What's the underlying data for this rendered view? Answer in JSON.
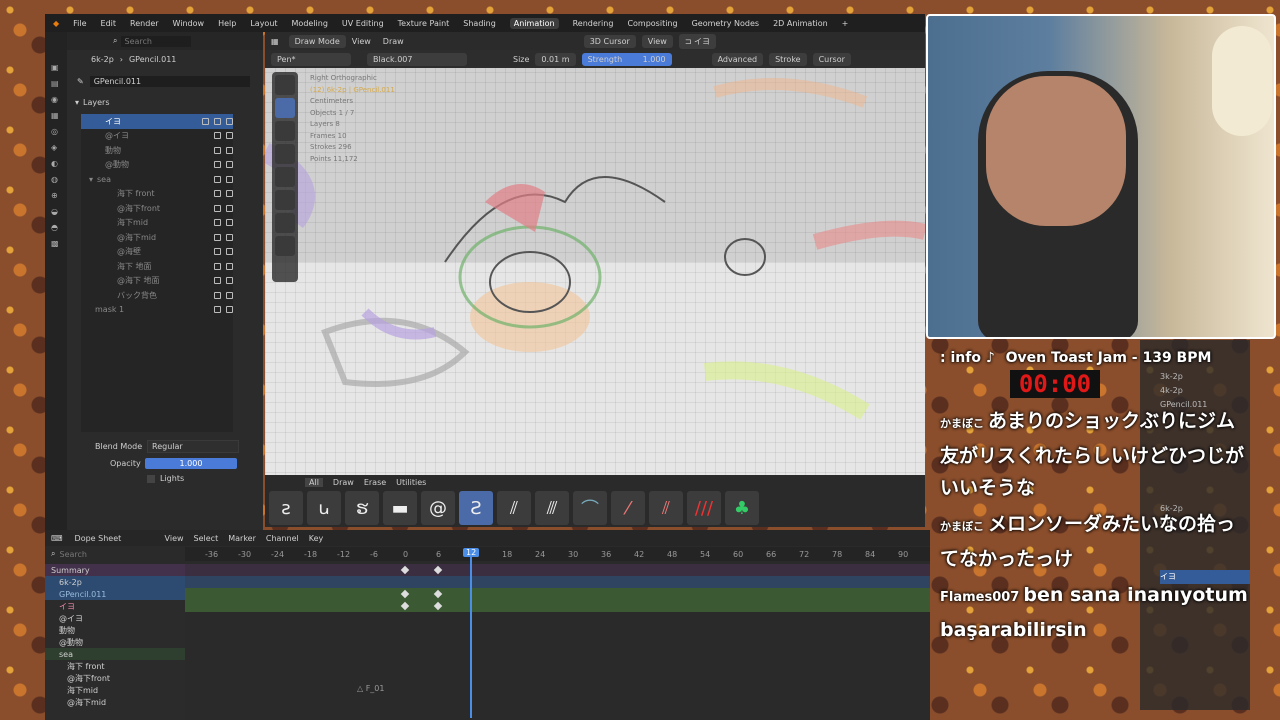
{
  "topbar": {
    "menus": [
      "File",
      "Edit",
      "Render",
      "Window",
      "Help"
    ],
    "workspaces": [
      "Layout",
      "Modeling",
      "UV Editing",
      "Texture Paint",
      "Shading",
      "Animation",
      "Rendering",
      "Compositing",
      "Geometry Nodes",
      "2D Animation"
    ],
    "active_workspace": "Animation",
    "plus": "+"
  },
  "props": {
    "object": "6k-2p",
    "data": "GPencil.011",
    "gp_name": "GPencil.011",
    "search_placeholder": "Search",
    "layers_title": "Layers",
    "layers": [
      "イヨ",
      "@イヨ",
      "動物",
      "@動物",
      "sea",
      "海下 front",
      "@海下front",
      "海下mid",
      "@海下mid",
      "@海壁",
      "海下 地面",
      "@海下 地面",
      "バック背色",
      "mask 1"
    ],
    "blend_mode_label": "Blend Mode",
    "blend_mode": "Regular",
    "opacity_label": "Opacity",
    "opacity": "1.000",
    "lights": "Lights"
  },
  "viewport": {
    "mode": "Draw Mode",
    "menus": [
      "View",
      "Draw"
    ],
    "cursor": "3D Cursor",
    "view": "View",
    "pen": "Pen*",
    "material": "Black.007",
    "size_label": "Size",
    "size": "0.01 m",
    "strength_label": "Strength",
    "strength": "1.000",
    "advanced": "Advanced",
    "stroke": "Stroke",
    "cursor2": "Cursor",
    "info": [
      "Right Orthographic",
      "(12) 6k-2p | GPencil.011",
      "Centimeters",
      "Objects   1 / 7",
      "Layers    8",
      "Frames    10",
      "Strokes   296",
      "Points    11,172"
    ]
  },
  "brushbar": {
    "tabs": [
      "All",
      "Draw",
      "Erase",
      "Utilities"
    ]
  },
  "dope": {
    "editor": "Dope Sheet",
    "menus": [
      "View",
      "Select",
      "Marker",
      "Channel",
      "Key"
    ],
    "search_placeholder": "Search",
    "ruler": [
      "-36",
      "-30",
      "-24",
      "-18",
      "-12",
      "-6",
      "0",
      "6",
      "12",
      "18",
      "24",
      "30",
      "36",
      "42",
      "48",
      "54",
      "60",
      "66",
      "72",
      "78",
      "84",
      "90"
    ],
    "current_frame": "12",
    "marker": "F_01",
    "channels": [
      "Summary",
      "6k-2p",
      "GPencil.011",
      "イヨ",
      "@イヨ",
      "動物",
      "@動物",
      "sea",
      "海下 front",
      "@海下front",
      "海下mid",
      "@海下mid"
    ]
  },
  "overlay": {
    "np_label": ": info ♪",
    "np_title": "Oven Toast Jam - 139 BPM",
    "timer": "00:00",
    "chat": [
      {
        "user": "かまぼこ",
        "text": "あまりのショックぶりにジム友がリスくれたらしいけどひつじがいいそうな"
      },
      {
        "user": "かまぼこ",
        "text": "メロンソーダみたいなの拾ってなかったっけ"
      },
      {
        "user": "Flames007",
        "text": "ben sana inanıyotum başarabilirsin"
      }
    ]
  },
  "side2": {
    "items": [
      "3k-2p",
      "4k-2p",
      "GPencil.011",
      "6k-2p",
      "GP",
      "イヨ"
    ]
  }
}
